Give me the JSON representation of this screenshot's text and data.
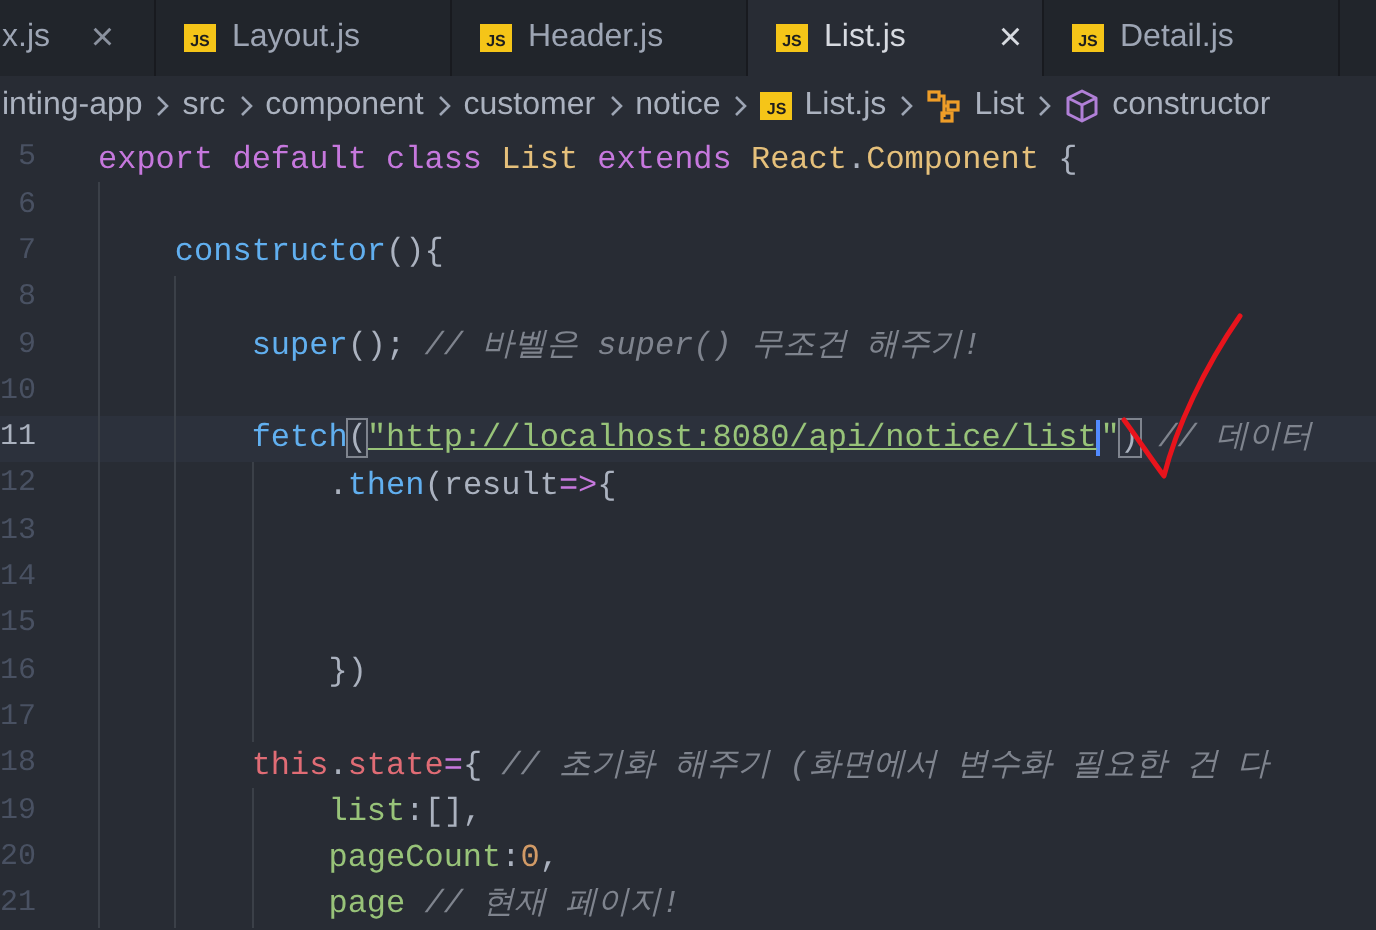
{
  "tabs": [
    {
      "label": "x.js",
      "selected": false,
      "close": "×"
    },
    {
      "label": "Layout.js",
      "icon_text": "JS",
      "selected": false
    },
    {
      "label": "Header.js",
      "icon_text": "JS",
      "selected": false
    },
    {
      "label": "List.js",
      "icon_text": "JS",
      "selected": true,
      "close": "×"
    },
    {
      "label": "Detail.js",
      "icon_text": "JS",
      "selected": false
    }
  ],
  "breadcrumb": [
    {
      "text": "inting-app",
      "kind": "folder"
    },
    {
      "text": "src",
      "kind": "folder"
    },
    {
      "text": "component",
      "kind": "folder"
    },
    {
      "text": "customer",
      "kind": "folder"
    },
    {
      "text": "notice",
      "kind": "folder"
    },
    {
      "text": "List.js",
      "kind": "file",
      "icon_text": "JS"
    },
    {
      "text": "List",
      "kind": "class"
    },
    {
      "text": "constructor",
      "kind": "method"
    }
  ],
  "editor": {
    "lines": [
      {
        "number": "5",
        "active": false,
        "tokens": [
          {
            "text": "export default class ",
            "kind": "keyword"
          },
          {
            "text": "List ",
            "kind": "type"
          },
          {
            "text": "extends ",
            "kind": "keyword"
          },
          {
            "text": "React",
            "kind": "type"
          },
          {
            "text": ".",
            "kind": "punct"
          },
          {
            "text": "Component ",
            "kind": "type"
          },
          {
            "text": "{",
            "kind": "punct"
          }
        ]
      },
      {
        "number": "6",
        "active": false
      },
      {
        "number": "7",
        "active": false,
        "tokens": [
          {
            "text": "    constructor",
            "kind": "func"
          },
          {
            "text": "(){",
            "kind": "punct"
          }
        ]
      },
      {
        "number": "8",
        "active": false
      },
      {
        "number": "9",
        "active": false,
        "tokens": [
          {
            "text": "        super",
            "kind": "func"
          },
          {
            "text": "(); ",
            "kind": "punct"
          },
          {
            "text": "// 바벨은 super() 무조건 해주기!",
            "kind": "comment"
          }
        ]
      },
      {
        "number": "10",
        "active": false
      },
      {
        "number": "11",
        "active": true,
        "tokens": [
          {
            "text": "        fetch",
            "kind": "func"
          },
          {
            "text": "(",
            "kind": "punct",
            "bracket_match": true
          },
          {
            "text": "\"http://localhost:8080/api/notice/list",
            "kind": "string",
            "underlined": true,
            "cursor_after": true
          },
          {
            "text": "\"",
            "kind": "string"
          },
          {
            "text": ")",
            "kind": "punct",
            "bracket_match": true
          },
          {
            "text": " // 데이터",
            "kind": "comment"
          }
        ]
      },
      {
        "number": "12",
        "active": false,
        "tokens": [
          {
            "text": "            .",
            "kind": "punct"
          },
          {
            "text": "then",
            "kind": "func"
          },
          {
            "text": "(",
            "kind": "punct"
          },
          {
            "text": "result",
            "kind": "param"
          },
          {
            "text": "=>",
            "kind": "keyword"
          },
          {
            "text": "{",
            "kind": "punct"
          }
        ]
      },
      {
        "number": "13",
        "active": false
      },
      {
        "number": "14",
        "active": false
      },
      {
        "number": "15",
        "active": false
      },
      {
        "number": "16",
        "active": false,
        "tokens": [
          {
            "text": "            })",
            "kind": "punct"
          }
        ]
      },
      {
        "number": "17",
        "active": false
      },
      {
        "number": "18",
        "active": false,
        "tokens": [
          {
            "text": "        this",
            "kind": "this"
          },
          {
            "text": ".",
            "kind": "punct"
          },
          {
            "text": "state",
            "kind": "this"
          },
          {
            "text": "=",
            "kind": "keyword"
          },
          {
            "text": "{ ",
            "kind": "punct"
          },
          {
            "text": "// 초기화 해주기 (화면에서 변수화 필요한 건 다",
            "kind": "comment"
          }
        ]
      },
      {
        "number": "19",
        "active": false,
        "tokens": [
          {
            "text": "            list",
            "kind": "key"
          },
          {
            "text": ":[],",
            "kind": "punct"
          }
        ]
      },
      {
        "number": "20",
        "active": false,
        "tokens": [
          {
            "text": "            pageCount",
            "kind": "key"
          },
          {
            "text": ":",
            "kind": "punct"
          },
          {
            "text": "0",
            "kind": "number"
          },
          {
            "text": ",",
            "kind": "punct"
          }
        ]
      },
      {
        "number": "21",
        "active": false,
        "tokens": [
          {
            "text": "            page ",
            "kind": "key"
          },
          {
            "text": "// 현재 페이지!",
            "kind": "comment"
          }
        ]
      }
    ]
  }
}
